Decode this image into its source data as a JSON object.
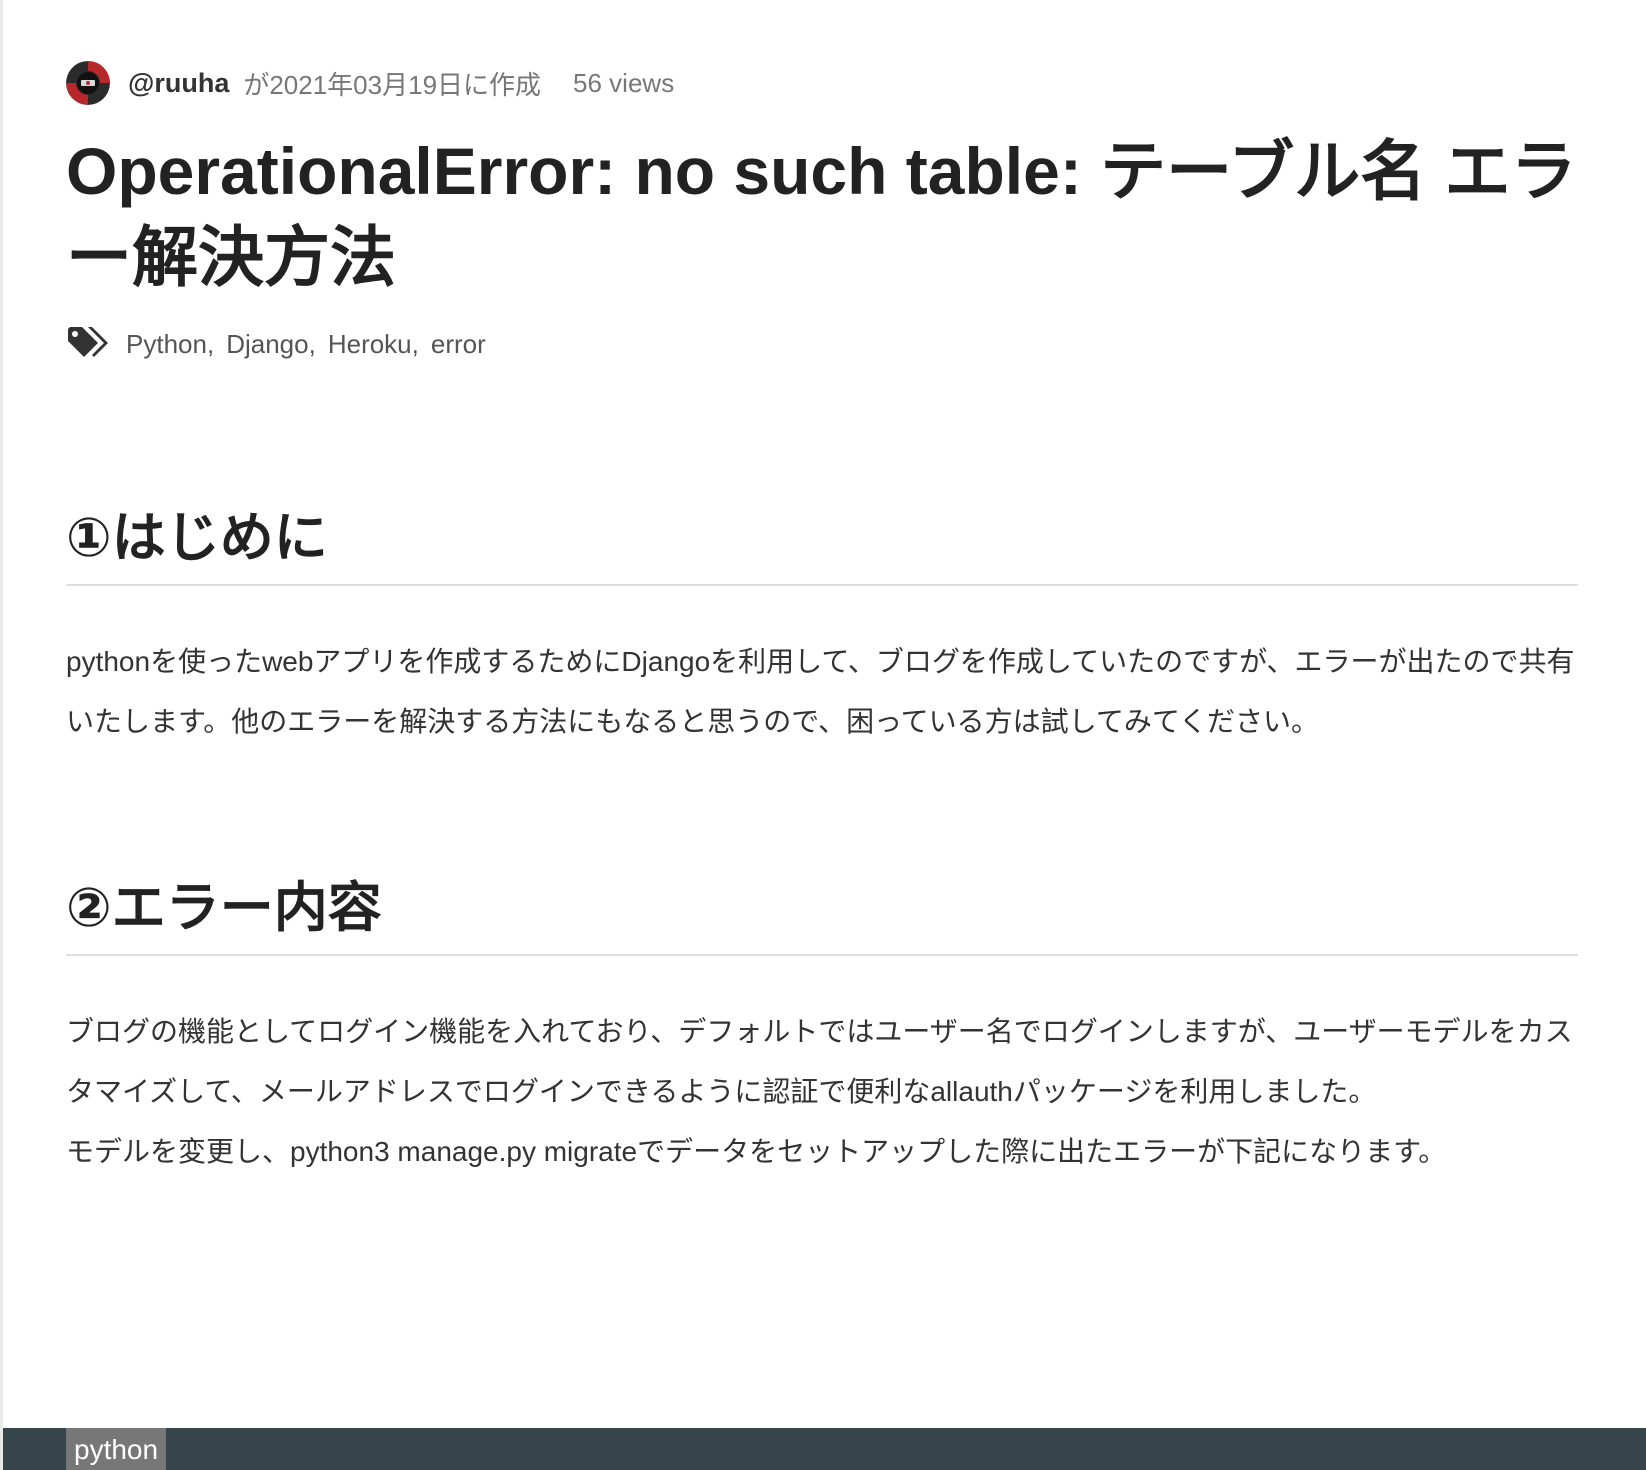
{
  "author": {
    "username": "@ruuha",
    "created": "が2021年03月19日に作成",
    "views": "56 views"
  },
  "article": {
    "title": "OperationalError: no such table: テーブル名 エラー解決方法",
    "tags": [
      "Python",
      "Django",
      "Heroku",
      "error"
    ],
    "tag_separator": ",",
    "sections": [
      {
        "heading": "①はじめに",
        "paragraph_lines": [
          "pythonを使ったwebアプリを作成するためにDjangoを利用して、ブログを作成していたのですが、エラーが出たので共有いたします。他のエラーを解決する方法にもなると思うので、困っている方は試してみてください。"
        ]
      },
      {
        "heading": "②エラー内容",
        "paragraph_lines": [
          "ブログの機能としてログイン機能を入れており、デフォルトではユーザー名でログインしますが、ユーザーモデルをカスタマイズして、メールアドレスでログインできるように認証で便利なallauthパッケージを利用しました。",
          "モデルを変更し、python3 manage.py migrateでデータをセットアップした際に出たエラーが下記になります。"
        ]
      }
    ]
  },
  "code_block": {
    "language": "python"
  },
  "colors": {
    "code_background": "#364549",
    "code_label_background": "#777777",
    "divider": "#dddddd"
  },
  "icons": {
    "tag": "tags-icon",
    "avatar": "avatar-image"
  }
}
